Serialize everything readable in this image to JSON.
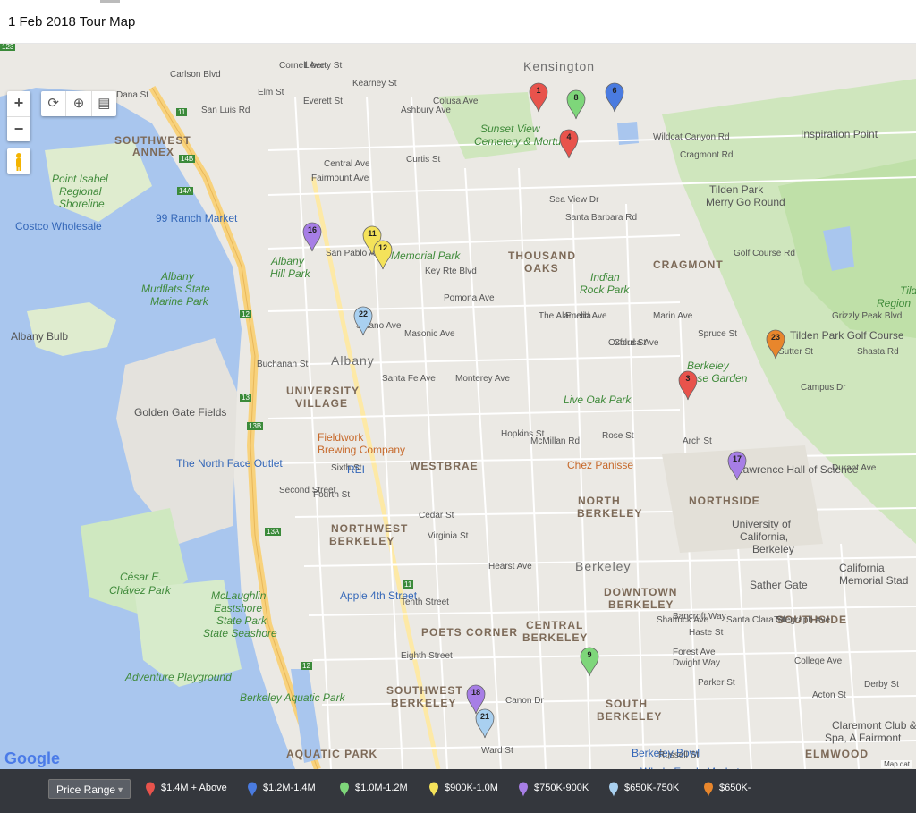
{
  "header": {
    "title": "1 Feb 2018 Tour Map"
  },
  "controls": {
    "zoom_in": "+",
    "zoom_out": "−",
    "refresh_icon": "refresh-icon",
    "locate_icon": "locate-icon",
    "print_icon": "print-icon",
    "pegman_icon": "pegman-icon"
  },
  "map": {
    "attribution_logo": "Google",
    "map_data": "Map dat",
    "labels": [
      {
        "k": "city",
        "t": "Kensington"
      },
      {
        "k": "dist",
        "t": "SOUTHWEST"
      },
      {
        "k": "dist",
        "t": "ANNEX"
      },
      {
        "k": "park",
        "t": "Point Isabel"
      },
      {
        "k": "park",
        "t": "Regional"
      },
      {
        "k": "park",
        "t": "Shoreline"
      },
      {
        "k": "blue",
        "t": "Costco Wholesale"
      },
      {
        "k": "blue",
        "t": "99 Ranch Market"
      },
      {
        "k": "park",
        "t": "Sunset View"
      },
      {
        "k": "park",
        "t": "Cemetery & Mortuary"
      },
      {
        "k": "poi",
        "t": "Tilden Park"
      },
      {
        "k": "poi",
        "t": "Merry Go Round"
      },
      {
        "k": "poi",
        "t": "Inspiration Point"
      },
      {
        "k": "park",
        "t": "Albany"
      },
      {
        "k": "park",
        "t": "Hill Park"
      },
      {
        "k": "park",
        "t": "Memorial Park"
      },
      {
        "k": "dist",
        "t": "THOUSAND"
      },
      {
        "k": "dist",
        "t": "OAKS"
      },
      {
        "k": "park",
        "t": "Indian"
      },
      {
        "k": "park",
        "t": "Rock Park"
      },
      {
        "k": "dist",
        "t": "CRAGMONT"
      },
      {
        "k": "park",
        "t": "Albany"
      },
      {
        "k": "park",
        "t": "Mudflats State"
      },
      {
        "k": "park",
        "t": "Marine Park"
      },
      {
        "k": "poi",
        "t": "Albany Bulb"
      },
      {
        "k": "poi",
        "t": "Tilden Park Golf Course"
      },
      {
        "k": "park",
        "t": "Tild"
      },
      {
        "k": "park",
        "t": "Region"
      },
      {
        "k": "city",
        "t": "Albany"
      },
      {
        "k": "dist",
        "t": "UNIVERSITY"
      },
      {
        "k": "dist",
        "t": "VILLAGE"
      },
      {
        "k": "poi",
        "t": "Golden Gate Fields"
      },
      {
        "k": "park",
        "t": "Berkeley"
      },
      {
        "k": "park",
        "t": "Rose Garden"
      },
      {
        "k": "park",
        "t": "Live Oak Park"
      },
      {
        "k": "orange",
        "t": "Fieldwork"
      },
      {
        "k": "orange",
        "t": "Brewing Company"
      },
      {
        "k": "blue",
        "t": "The North Face Outlet"
      },
      {
        "k": "blue",
        "t": "REI"
      },
      {
        "k": "dist",
        "t": "WESTBRAE"
      },
      {
        "k": "orange",
        "t": "Chez Panisse"
      },
      {
        "k": "poi",
        "t": "Lawrence Hall of Science"
      },
      {
        "k": "dist",
        "t": "NORTH"
      },
      {
        "k": "dist",
        "t": "BERKELEY"
      },
      {
        "k": "dist",
        "t": "NORTHSIDE"
      },
      {
        "k": "poi",
        "t": "University of"
      },
      {
        "k": "poi",
        "t": "California,"
      },
      {
        "k": "poi",
        "t": "Berkeley"
      },
      {
        "k": "dist",
        "t": "NORTHWEST"
      },
      {
        "k": "dist",
        "t": "BERKELEY"
      },
      {
        "k": "park",
        "t": "César E."
      },
      {
        "k": "park",
        "t": "Chávez Park"
      },
      {
        "k": "city",
        "t": "Berkeley"
      },
      {
        "k": "poi",
        "t": "California"
      },
      {
        "k": "poi",
        "t": "Memorial Stad"
      },
      {
        "k": "poi",
        "t": "Sather Gate"
      },
      {
        "k": "park",
        "t": "McLaughlin"
      },
      {
        "k": "park",
        "t": "Eastshore"
      },
      {
        "k": "park",
        "t": "State Park"
      },
      {
        "k": "park",
        "t": "State Seashore"
      },
      {
        "k": "blue",
        "t": "Apple 4th Street"
      },
      {
        "k": "dist",
        "t": "DOWNTOWN"
      },
      {
        "k": "dist",
        "t": "BERKELEY"
      },
      {
        "k": "dist",
        "t": "SOUTHSIDE"
      },
      {
        "k": "dist",
        "t": "POETS CORNER"
      },
      {
        "k": "dist",
        "t": "CENTRAL"
      },
      {
        "k": "dist",
        "t": "BERKELEY"
      },
      {
        "k": "park",
        "t": "Adventure Playground"
      },
      {
        "k": "park",
        "t": "Berkeley Aquatic Park"
      },
      {
        "k": "dist",
        "t": "SOUTHWEST"
      },
      {
        "k": "dist",
        "t": "BERKELEY"
      },
      {
        "k": "dist",
        "t": "SOUTH"
      },
      {
        "k": "dist",
        "t": "BERKELEY"
      },
      {
        "k": "poi",
        "t": "Claremont Club &"
      },
      {
        "k": "poi",
        "t": "Spa, A Fairmont"
      },
      {
        "k": "dist",
        "t": "AQUATIC PARK"
      },
      {
        "k": "blue",
        "t": "Berkeley Bowl"
      },
      {
        "k": "dist",
        "t": "ELMWOOD"
      },
      {
        "k": "blue",
        "t": "Whole Foods Market"
      },
      {
        "k": "blue",
        "t": "Berkeley Bowl West"
      },
      {
        "k": "street",
        "t": "Carlson Blvd"
      },
      {
        "k": "street",
        "t": "Central Ave"
      },
      {
        "k": "street",
        "t": "Fairmount Ave"
      },
      {
        "k": "street",
        "t": "Buchanan St"
      },
      {
        "k": "street",
        "t": "Solano Ave"
      },
      {
        "k": "street",
        "t": "Hopkins St"
      },
      {
        "k": "street",
        "t": "Rose St"
      },
      {
        "k": "street",
        "t": "Cedar St"
      },
      {
        "k": "street",
        "t": "Virginia St"
      },
      {
        "k": "street",
        "t": "Hearst Ave"
      },
      {
        "k": "street",
        "t": "Bancroft Way"
      },
      {
        "k": "street",
        "t": "Dwight Way"
      },
      {
        "k": "street",
        "t": "Parker St"
      },
      {
        "k": "street",
        "t": "Derby St"
      },
      {
        "k": "street",
        "t": "Russell St"
      },
      {
        "k": "street",
        "t": "Ward St"
      },
      {
        "k": "street",
        "t": "San Pablo Ave"
      },
      {
        "k": "street",
        "t": "Sixth St"
      },
      {
        "k": "street",
        "t": "Fourth St"
      },
      {
        "k": "street",
        "t": "Second Street"
      },
      {
        "k": "street",
        "t": "Tenth Street"
      },
      {
        "k": "street",
        "t": "Eighth Street"
      },
      {
        "k": "street",
        "t": "Masonic Ave"
      },
      {
        "k": "street",
        "t": "Key Rte Blvd"
      },
      {
        "k": "street",
        "t": "Shattuck Ave"
      },
      {
        "k": "street",
        "t": "Telegraph Ave"
      },
      {
        "k": "street",
        "t": "College Ave"
      },
      {
        "k": "street",
        "t": "Arch St"
      },
      {
        "k": "street",
        "t": "Spruce St"
      },
      {
        "k": "street",
        "t": "Euclid Ave"
      },
      {
        "k": "street",
        "t": "The Alameda"
      },
      {
        "k": "street",
        "t": "Colusa Ave"
      },
      {
        "k": "street",
        "t": "Marin Ave"
      },
      {
        "k": "street",
        "t": "Oxford St"
      },
      {
        "k": "street",
        "t": "Sutter St"
      },
      {
        "k": "street",
        "t": "Campus Dr"
      },
      {
        "k": "street",
        "t": "Grizzly Peak Blvd"
      },
      {
        "k": "street",
        "t": "Shasta Rd"
      },
      {
        "k": "street",
        "t": "Golf Course Rd"
      },
      {
        "k": "street",
        "t": "Cragmont Rd"
      },
      {
        "k": "street",
        "t": "Wildcat Canyon Rd"
      },
      {
        "k": "street",
        "t": "Canon Dr"
      },
      {
        "k": "street",
        "t": "Acton St"
      },
      {
        "k": "street",
        "t": "Forest Ave"
      },
      {
        "k": "street",
        "t": "Haste St"
      },
      {
        "k": "street",
        "t": "Durant Ave"
      },
      {
        "k": "street",
        "t": "McMillan Rd"
      },
      {
        "k": "street",
        "t": "Monterey Ave"
      },
      {
        "k": "street",
        "t": "Curtis St"
      },
      {
        "k": "street",
        "t": "Pomona Ave"
      },
      {
        "k": "street",
        "t": "Santa Fe Ave"
      },
      {
        "k": "street",
        "t": "Cornell Ave"
      },
      {
        "k": "street",
        "t": "Liberty St"
      },
      {
        "k": "street",
        "t": "Everett St"
      },
      {
        "k": "street",
        "t": "Elm St"
      },
      {
        "k": "street",
        "t": "Kearney St"
      },
      {
        "k": "street",
        "t": "Ashbury Ave"
      },
      {
        "k": "street",
        "t": "Colusa Ave"
      },
      {
        "k": "street",
        "t": "Sea View Dr"
      },
      {
        "k": "street",
        "t": "Santa Barbara Rd"
      },
      {
        "k": "street",
        "t": "San Luis Rd"
      },
      {
        "k": "street",
        "t": "Santa Clara St"
      },
      {
        "k": "street",
        "t": "Dana St"
      },
      {
        "k": "small",
        "t": "11"
      },
      {
        "k": "small",
        "t": "14B"
      },
      {
        "k": "small",
        "t": "14A"
      },
      {
        "k": "small",
        "t": "12"
      },
      {
        "k": "small",
        "t": "13"
      },
      {
        "k": "small",
        "t": "13B"
      },
      {
        "k": "small",
        "t": "13A"
      },
      {
        "k": "small",
        "t": "12"
      },
      {
        "k": "small",
        "t": "11"
      },
      {
        "k": "small",
        "t": "123"
      }
    ],
    "pins": [
      {
        "n": "1",
        "c": "#e8534c"
      },
      {
        "n": "8",
        "c": "#7ed67a"
      },
      {
        "n": "6",
        "c": "#4a7be0"
      },
      {
        "n": "4",
        "c": "#e8534c"
      },
      {
        "n": "16",
        "c": "#a77ee6"
      },
      {
        "n": "11",
        "c": "#f4e25a"
      },
      {
        "n": "12",
        "c": "#f4e25a"
      },
      {
        "n": "22",
        "c": "#a9d0f0"
      },
      {
        "n": "23",
        "c": "#e8862c"
      },
      {
        "n": "3",
        "c": "#e8534c"
      },
      {
        "n": "17",
        "c": "#a77ee6"
      },
      {
        "n": "9",
        "c": "#7ed67a"
      },
      {
        "n": "18",
        "c": "#a77ee6"
      },
      {
        "n": "21",
        "c": "#a9d0f0"
      }
    ]
  },
  "legend": {
    "button_label": "Price Range",
    "button_caret": "▼",
    "items": [
      {
        "label": "$1.4M + Above",
        "color": "#e8534c"
      },
      {
        "label": "$1.2M-1.4M",
        "color": "#4a7be0"
      },
      {
        "label": "$1.0M-1.2M",
        "color": "#7ed67a"
      },
      {
        "label": "$900K-1.0M",
        "color": "#f4e25a"
      },
      {
        "label": "$750K-900K",
        "color": "#a77ee6"
      },
      {
        "label": "$650K-750K",
        "color": "#a9d0f0"
      },
      {
        "label": "$650K-",
        "color": "#e8862c"
      }
    ]
  }
}
